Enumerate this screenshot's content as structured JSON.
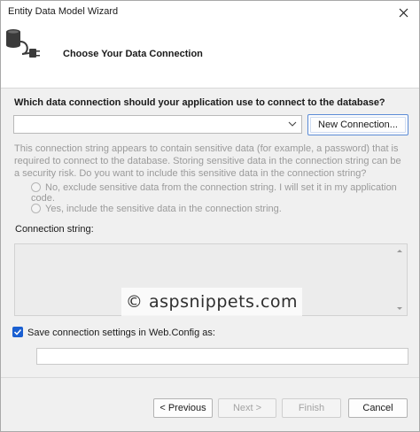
{
  "window": {
    "title": "Entity Data Model Wizard"
  },
  "header": {
    "title": "Choose Your Data Connection",
    "icon": "database-plug-icon"
  },
  "connection": {
    "question": "Which data connection should your application use to connect to the database?",
    "selected_value": "",
    "new_connection_label": "New Connection..."
  },
  "sensitive": {
    "description": "This connection string appears to contain sensitive data (for example, a password) that is required to connect to the database. Storing sensitive data in the connection string can be a security risk. Do you want to include this sensitive data in the connection string?",
    "option_exclude": "No, exclude sensitive data from the connection string. I will set it in my application code.",
    "option_include": "Yes, include the sensitive data in the connection string."
  },
  "connection_string": {
    "label": "Connection string:",
    "value": ""
  },
  "watermark": "© aspsnippets.com",
  "save": {
    "label": "Save connection settings in Web.Config as:",
    "checked": true,
    "value": ""
  },
  "buttons": {
    "previous": "< Previous",
    "next": "Next >",
    "finish": "Finish",
    "cancel": "Cancel"
  },
  "colors": {
    "accent": "#1a5fd1",
    "disabled_text": "#9a9a9a",
    "dialog_bg": "#f0f0f0"
  }
}
